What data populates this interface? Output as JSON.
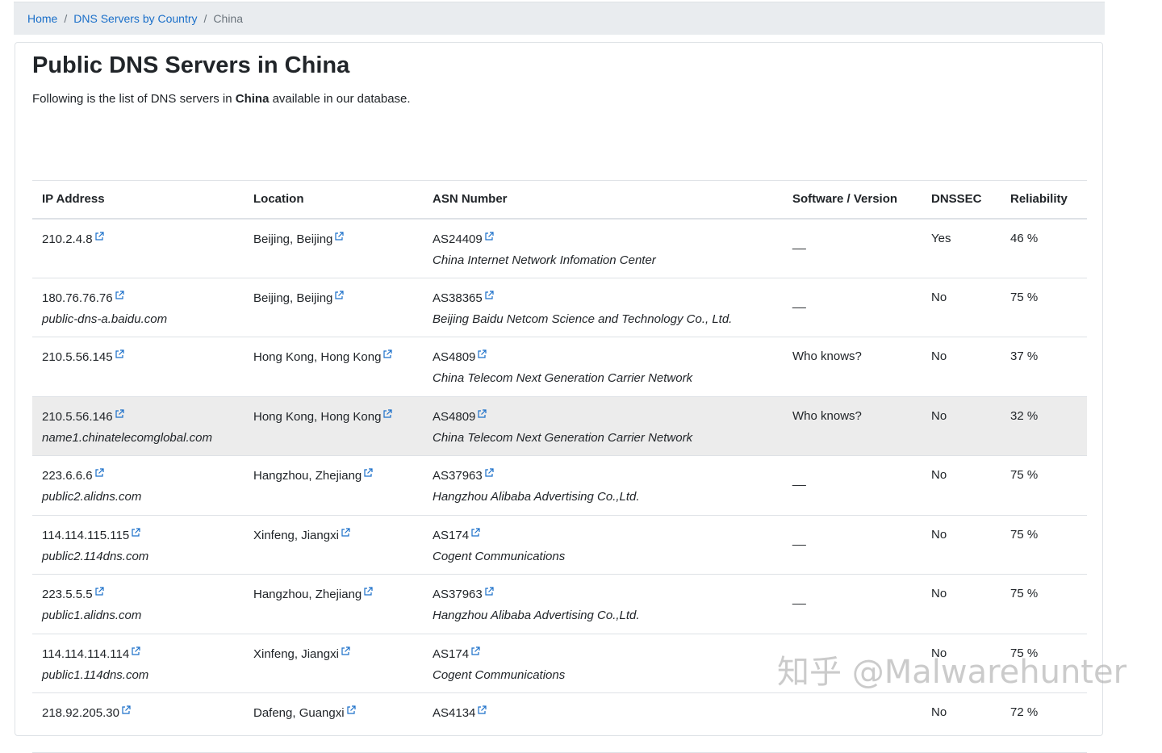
{
  "breadcrumb": {
    "home": "Home",
    "separator": "/",
    "countries": "DNS Servers by Country",
    "current": "China"
  },
  "page": {
    "title": "Public DNS Servers in China",
    "intro_before": "Following is the list of DNS servers in ",
    "intro_country": "China",
    "intro_after": " available in our database."
  },
  "table": {
    "headers": {
      "ip": "IP Address",
      "location": "Location",
      "asn": "ASN Number",
      "software": "Software / Version",
      "dnssec": "DNSSEC",
      "reliability": "Reliability"
    },
    "rows": [
      {
        "ip": "210.2.4.8",
        "host": "",
        "location": "Beijing, Beijing",
        "asn": "AS24409",
        "org": "China Internet Network Infomation Center",
        "software": "__",
        "dnssec": "Yes",
        "reliability": "46 %"
      },
      {
        "ip": "180.76.76.76",
        "host": "public-dns-a.baidu.com",
        "location": "Beijing, Beijing",
        "asn": "AS38365",
        "org": "Beijing Baidu Netcom Science and Technology Co., Ltd.",
        "software": "__",
        "dnssec": "No",
        "reliability": "75 %"
      },
      {
        "ip": "210.5.56.145",
        "host": "",
        "location": "Hong Kong, Hong Kong",
        "asn": "AS4809",
        "org": "China Telecom Next Generation Carrier Network",
        "software": "Who knows?",
        "dnssec": "No",
        "reliability": "37 %"
      },
      {
        "ip": "210.5.56.146",
        "host": "name1.chinatelecomglobal.com",
        "location": "Hong Kong, Hong Kong",
        "asn": "AS4809",
        "org": "China Telecom Next Generation Carrier Network",
        "software": "Who knows?",
        "dnssec": "No",
        "reliability": "32 %"
      },
      {
        "ip": "223.6.6.6",
        "host": "public2.alidns.com",
        "location": "Hangzhou, Zhejiang",
        "asn": "AS37963",
        "org": "Hangzhou Alibaba Advertising Co.,Ltd.",
        "software": "__",
        "dnssec": "No",
        "reliability": "75 %"
      },
      {
        "ip": "114.114.115.115",
        "host": "public2.114dns.com",
        "location": "Xinfeng, Jiangxi",
        "asn": "AS174",
        "org": "Cogent Communications",
        "software": "__",
        "dnssec": "No",
        "reliability": "75 %"
      },
      {
        "ip": "223.5.5.5",
        "host": "public1.alidns.com",
        "location": "Hangzhou, Zhejiang",
        "asn": "AS37963",
        "org": "Hangzhou Alibaba Advertising Co.,Ltd.",
        "software": "__",
        "dnssec": "No",
        "reliability": "75 %"
      },
      {
        "ip": "114.114.114.114",
        "host": "public1.114dns.com",
        "location": "Xinfeng, Jiangxi",
        "asn": "AS174",
        "org": "Cogent Communications",
        "software": "",
        "dnssec": "No",
        "reliability": "75 %"
      },
      {
        "ip": "218.92.205.30",
        "host": "",
        "location": "Dafeng, Guangxi",
        "asn": "AS4134",
        "org": "",
        "software": "",
        "dnssec": "No",
        "reliability": "72 %"
      }
    ]
  },
  "watermark": "知乎 @Malwarehunter",
  "colors": {
    "link": "#1a6fc9",
    "breadcrumb_bg": "#e9ecef",
    "hover_row": "#ececec",
    "border": "#dee2e6"
  },
  "icons": {
    "external_link": "external-link-icon"
  }
}
